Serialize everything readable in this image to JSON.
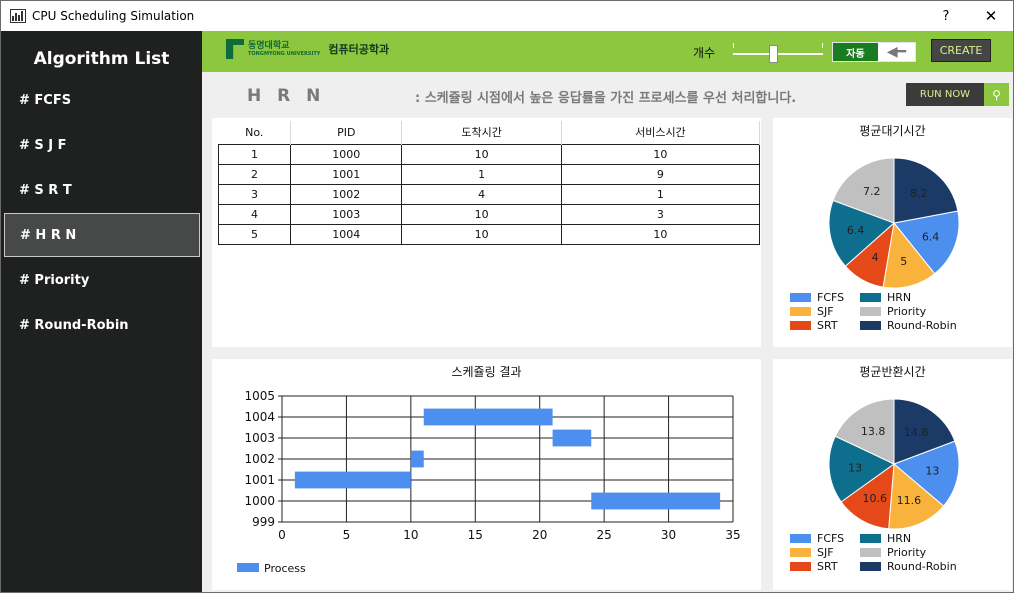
{
  "window": {
    "title": "CPU Scheduling Simulation",
    "help": "?",
    "close": "✕"
  },
  "sidebar": {
    "title": "Algorithm List",
    "items": [
      {
        "label": "# FCFS"
      },
      {
        "label": "# S J F"
      },
      {
        "label": "# S R T"
      },
      {
        "label": "# H R N",
        "active": true
      },
      {
        "label": "# Priority"
      },
      {
        "label": "# Round-Robin"
      }
    ]
  },
  "header": {
    "logo_univ": "동명대학교",
    "logo_sub": "TONGMYONG UNIVERSITY",
    "logo_dept": "컴퓨터공학과",
    "count_label": "개수",
    "toggle_label": "자동",
    "create_label": "CREATE",
    "accent": "#8dc63f"
  },
  "algo": {
    "name": "H R N",
    "description": ": 스케쥴링 시점에서 높은 응답률을 가진 프로세스를 우선 처리합니다.",
    "run_label": "RUN NOW",
    "run_icon": "search-icon"
  },
  "table": {
    "headers": [
      "No.",
      "PID",
      "도착시간",
      "서비스시간"
    ],
    "rows": [
      [
        "1",
        "1000",
        "10",
        "10"
      ],
      [
        "2",
        "1001",
        "1",
        "9"
      ],
      [
        "3",
        "1002",
        "4",
        "1"
      ],
      [
        "4",
        "1003",
        "10",
        "3"
      ],
      [
        "5",
        "1004",
        "10",
        "10"
      ]
    ]
  },
  "chart_data": [
    {
      "type": "pie",
      "title": "평균대기시간",
      "labels": [
        "FCFS",
        "SJF",
        "SRT",
        "HRN",
        "Priority",
        "Round-Robin"
      ],
      "values": [
        6.4,
        5,
        4,
        6.4,
        7.2,
        8.2
      ],
      "colors": [
        "#4c8fef",
        "#f9b33c",
        "#e5491a",
        "#0d6e8d",
        "#c0c0c0",
        "#1b3a66"
      ],
      "legend": "bottom"
    },
    {
      "type": "bar",
      "orientation": "gantt",
      "title": "스케쥴링 결과",
      "series": [
        {
          "name": "Process",
          "color": "#4c8fef"
        }
      ],
      "bars": [
        {
          "pid": 1001,
          "start": 1,
          "end": 10
        },
        {
          "pid": 1002,
          "start": 10,
          "end": 11
        },
        {
          "pid": 1004,
          "start": 11,
          "end": 21
        },
        {
          "pid": 1003,
          "start": 21,
          "end": 24
        },
        {
          "pid": 1000,
          "start": 24,
          "end": 34
        }
      ],
      "xlim": [
        0,
        35
      ],
      "xticks": [
        "0",
        "5",
        "10",
        "15",
        "20",
        "25",
        "30",
        "35"
      ],
      "ylim": [
        999,
        1005
      ],
      "yticks": [
        "999",
        "1000",
        "1001",
        "1002",
        "1003",
        "1004",
        "1005"
      ],
      "grid": true,
      "legend": "bottom-left"
    },
    {
      "type": "pie",
      "title": "평균반환시간",
      "labels": [
        "FCFS",
        "SJF",
        "SRT",
        "HRN",
        "Priority",
        "Round-Robin"
      ],
      "values": [
        13,
        11.6,
        10.6,
        13,
        13.8,
        14.8
      ],
      "colors": [
        "#4c8fef",
        "#f9b33c",
        "#e5491a",
        "#0d6e8d",
        "#c0c0c0",
        "#1b3a66"
      ],
      "legend": "bottom"
    }
  ]
}
